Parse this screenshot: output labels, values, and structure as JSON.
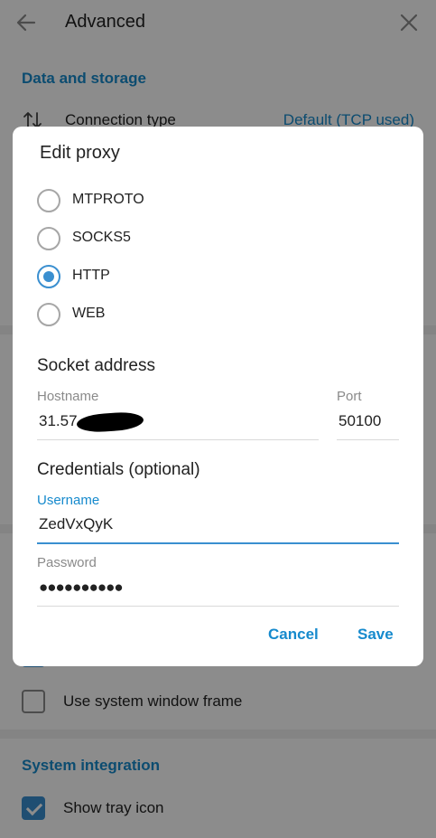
{
  "settings": {
    "title": "Advanced",
    "data_section": "Data and storage",
    "connection_label": "Connection type",
    "connection_value": "Default (TCP used)",
    "checkbox_system_frame": "Use system window frame",
    "integration_section": "System integration",
    "checkbox_tray_icon": "Show tray icon"
  },
  "dialog": {
    "title": "Edit proxy",
    "proxy_types": [
      {
        "label": "MTPROTO",
        "selected": false
      },
      {
        "label": "SOCKS5",
        "selected": false
      },
      {
        "label": "HTTP",
        "selected": true
      },
      {
        "label": "WEB",
        "selected": false
      }
    ],
    "socket_title": "Socket address",
    "hostname_label": "Hostname",
    "hostname_value": "31.57",
    "port_label": "Port",
    "port_value": "50100",
    "credentials_title": "Credentials (optional)",
    "username_label": "Username",
    "username_value": "ZedVxQyK",
    "password_label": "Password",
    "password_value": "●●●●●●●●●●",
    "cancel_label": "Cancel",
    "save_label": "Save"
  },
  "colors": {
    "accent": "#168acd",
    "radio_selected": "#3a8fd0",
    "overlay": "rgba(0,0,0,0.45)"
  }
}
